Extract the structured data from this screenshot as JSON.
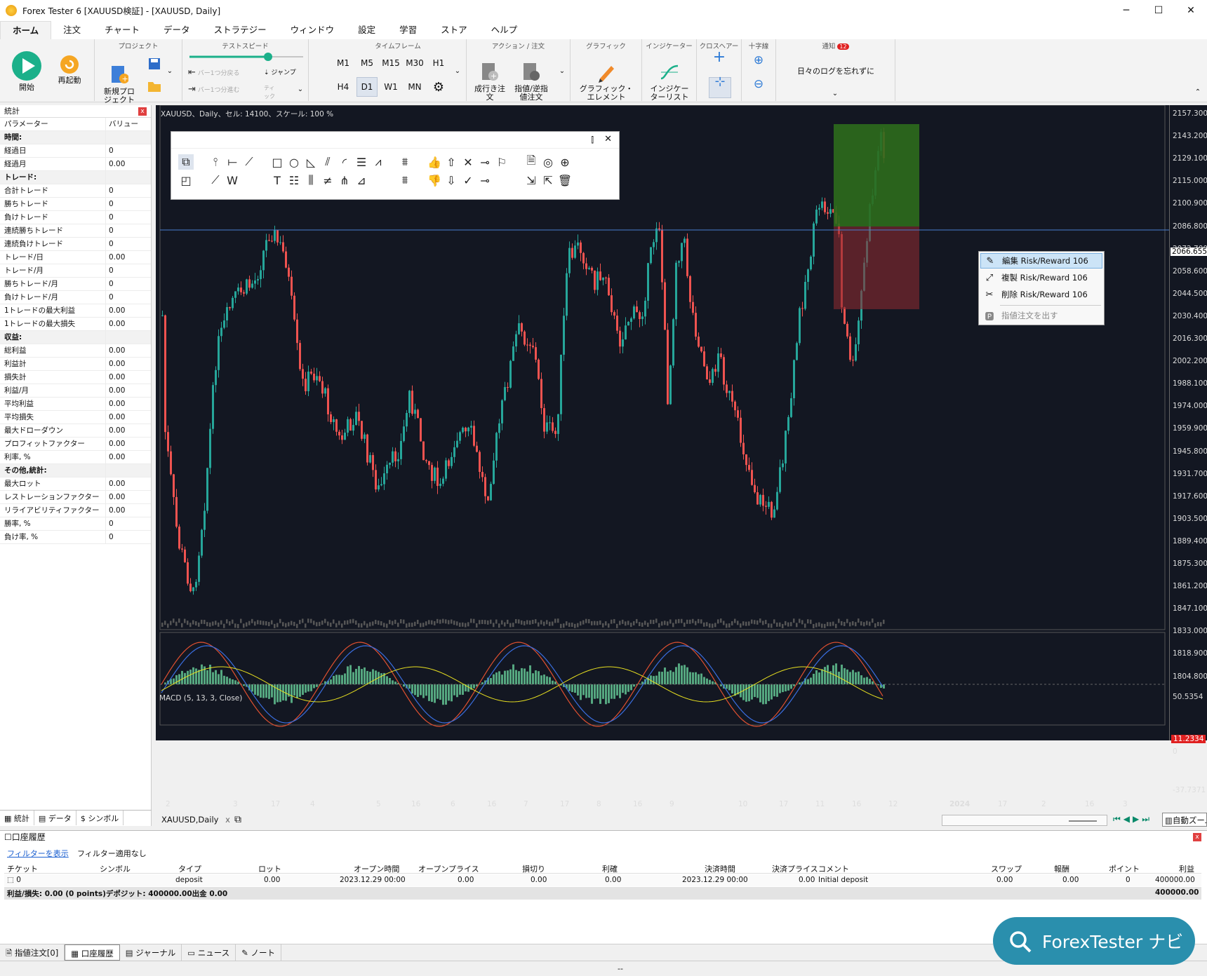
{
  "window": {
    "title": "Forex Tester 6  [XAUUSD検証] - [XAUUSD, Daily]",
    "min": "─",
    "max": "☐",
    "close": "✕"
  },
  "menu": [
    "ホーム",
    "注文",
    "チャート",
    "データ",
    "ストラテジー",
    "ウィンドウ",
    "設定",
    "学習",
    "ストア",
    "ヘルプ"
  ],
  "ribbon": {
    "start": "開始",
    "restart": "再起動",
    "project_group": "プロジェクト",
    "new_project": "新規プロ\nジェクト",
    "speed_group": "テストスピード",
    "bar_back": "バー1つ分戻る",
    "bar_fwd": "バー1つ分進む",
    "jump": "ジャンプ",
    "tick": "ティ\nック",
    "tf_group": "タイムフレーム",
    "tfs": [
      "M1",
      "M5",
      "M15",
      "M30",
      "H1",
      "H4",
      "D1",
      "W1",
      "MN"
    ],
    "tf_active": "D1",
    "action_group": "アクション / 注文",
    "market_order": "成行き注\n文",
    "pending_order": "指値/逆指\n値注文",
    "graphic_group": "グラフィック",
    "graphic_element": "グラフィック・\nエレメント",
    "indicator_group": "インジケーター",
    "indicator_list": "インジケー\nターリスト",
    "crosshair_group": "クロスヘアー",
    "cross_group": "十字線",
    "notify_group": "通知",
    "notify_count": "12",
    "notify_text": "日々のログを忘れずに"
  },
  "stats": {
    "title": "統計",
    "col_param": "パラメーター",
    "col_value": "バリュー",
    "rows": [
      {
        "k": "時間:",
        "v": "",
        "sec": true
      },
      {
        "k": "経過日",
        "v": "0"
      },
      {
        "k": "経過月",
        "v": "0.00"
      },
      {
        "k": "トレード:",
        "v": "",
        "sec": true
      },
      {
        "k": "合計トレード",
        "v": "0"
      },
      {
        "k": "勝ちトレード",
        "v": "0"
      },
      {
        "k": "負けトレード",
        "v": "0"
      },
      {
        "k": "連続勝ちトレード",
        "v": "0"
      },
      {
        "k": "連続負けトレード",
        "v": "0"
      },
      {
        "k": "トレード/日",
        "v": "0.00"
      },
      {
        "k": "トレード/月",
        "v": "0"
      },
      {
        "k": "勝ちトレード/月",
        "v": "0"
      },
      {
        "k": "負けトレード/月",
        "v": "0"
      },
      {
        "k": "1トレードの最大利益",
        "v": "0.00"
      },
      {
        "k": "1トレードの最大損失",
        "v": "0.00"
      },
      {
        "k": "収益:",
        "v": "",
        "sec": true
      },
      {
        "k": "総利益",
        "v": "0.00"
      },
      {
        "k": "利益計",
        "v": "0.00"
      },
      {
        "k": "損失計",
        "v": "0.00"
      },
      {
        "k": "利益/月",
        "v": "0.00"
      },
      {
        "k": "平均利益",
        "v": "0.00"
      },
      {
        "k": "平均損失",
        "v": "0.00"
      },
      {
        "k": "最大ドローダウン",
        "v": "0.00"
      },
      {
        "k": "プロフィットファクター",
        "v": "0.00"
      },
      {
        "k": "利率, %",
        "v": "0.00"
      },
      {
        "k": "その他,統計:",
        "v": "",
        "sec": true
      },
      {
        "k": "最大ロット",
        "v": "0.00"
      },
      {
        "k": "レストレーションファクター",
        "v": "0.00"
      },
      {
        "k": "リライアビリティファクター",
        "v": "0.00"
      },
      {
        "k": "勝率, %",
        "v": "0"
      },
      {
        "k": "負け率, %",
        "v": "0"
      }
    ],
    "tabs": [
      "統計",
      "データ",
      "シンボル"
    ]
  },
  "chart": {
    "info": "XAUUSD、Daily、セル: 14100、スケール: 100 %",
    "macd_info": "MACD (5, 13, 3, Close)",
    "price_levels": [
      "2157.300",
      "2143.200",
      "2129.100",
      "2115.000",
      "2100.900",
      "2086.800",
      "2072.700",
      "2058.600",
      "2044.500",
      "2030.400",
      "2016.300",
      "2002.200",
      "1988.100",
      "1974.000",
      "1959.900",
      "1945.800",
      "1931.700",
      "1917.600",
      "1903.500",
      "1889.400",
      "1875.300",
      "1861.200",
      "1847.100",
      "1833.000",
      "1818.900",
      "1804.800"
    ],
    "current_price": "2066.655",
    "macd_levels": [
      "50.5354",
      "0",
      "-37.7371"
    ],
    "macd_current": "11.2334",
    "x_labels": [
      "2",
      "3",
      "17",
      "4",
      "5",
      "16",
      "6",
      "16",
      "7",
      "17",
      "8",
      "16",
      "9",
      "10",
      "17",
      "11",
      "16",
      "12",
      "2024",
      "17",
      "2",
      "16",
      "3"
    ],
    "tab": "XAUUSD,Daily",
    "tab_close": "x",
    "auto_zoom": "自動ズーム",
    "up_color": "#26a69a",
    "down_color": "#ef5350"
  },
  "context_menu": {
    "items": [
      "編集 Risk/Reward 106",
      "複製 Risk/Reward 106",
      "削除 Risk/Reward 106",
      "指値注文を出す"
    ]
  },
  "history": {
    "title": "口座履歴",
    "filter_link": "フィルターを表示",
    "filter_status": "フィルター適用なし",
    "headers": [
      "チケット",
      "シンボル",
      "タイプ",
      "ロット",
      "オープン時間",
      "オープンプライス",
      "損切り",
      "利確",
      "決済時間",
      "決済プライス",
      "コメント",
      "スワップ",
      "報酬",
      "ポイント",
      "利益"
    ],
    "row": [
      "0",
      "",
      "deposit",
      "0.00",
      "2023.12.29 00:00",
      "0.00",
      "0.00",
      "0.00",
      "2023.12.29 00:00",
      "0.00",
      "Initial deposit",
      "0.00",
      "0.00",
      "0",
      "400000.00"
    ],
    "footer": "利益/損失: 0.00 (0 points)デポジット: 400000.00出金 0.00",
    "footer_total": "400000.00"
  },
  "bottom_tabs": [
    "指値注文[0]",
    "口座履歴",
    "ジャーナル",
    "ニュース",
    "ノート"
  ],
  "status": "--",
  "navi": "ForexTester ナビ"
}
